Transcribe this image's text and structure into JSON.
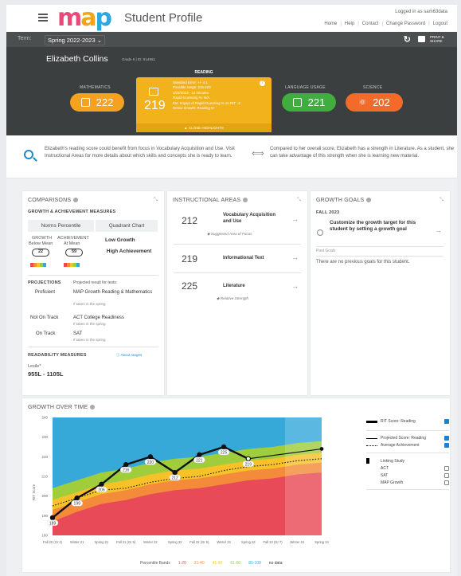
{
  "app": {
    "page_title": "Student Profile",
    "logged_in": "Logged in as sam63data",
    "links": [
      "Home",
      "Help",
      "Contact",
      "Change Password",
      "Logout"
    ]
  },
  "termbar": {
    "label": "Term:",
    "term": "Spring 2022-2023",
    "print_label": "PRINT & SHARE"
  },
  "student": {
    "name": "Elizabeth Collins",
    "meta": "Grade 6  |  ID: 514961"
  },
  "subjects": {
    "math": {
      "label": "MATHEMATICS",
      "score": "222",
      "color": "#f4a21f"
    },
    "reading": {
      "label": "READING",
      "score": "219",
      "color": "#f2b21c",
      "details": [
        "Standard Error: +/- 4.1",
        "Possible range: 215-223",
        "3/23/2023 - 12 minutes",
        "Rapid-Guessing %: N/A",
        "Est. Impact of Rapid-Guessing % on RIT: -2",
        "Derive Growth: Reading 6+"
      ],
      "close": "▲ CLOSE HIGHLIGHTS"
    },
    "language": {
      "label": "LANGUAGE USAGE",
      "score": "221",
      "color": "#3fae3f"
    },
    "science": {
      "label": "SCIENCE",
      "score": "202",
      "color": "#f26b2a"
    }
  },
  "insights": [
    "Elizabeth's reading score could benefit from focus in Vocabulary Acquisition and Use. Visit Instructional Areas for more details about which skills and concepts she is ready to learn.",
    "Compared to her overall score, Elizabeth has a strength in Literature. As a student, she can take advantage of this strength when she is learning new material."
  ],
  "comparisons": {
    "title": "COMPARISONS",
    "subtitle": "GROWTH & ACHIEVEMENT MEASURES",
    "tab_norms": "Norms Percentile",
    "tab_quadrant": "Quadrant Chart",
    "growth_label": "GROWTH",
    "growth_desc": "Below Mean",
    "growth_pct": "22",
    "achievement_label": "ACHIEVEMENT",
    "achievement_desc": "At Mean",
    "achievement_pct": "59",
    "quadrant_growth": "Low Growth",
    "quadrant_achievement": "High Achievement",
    "projections_title": "PROJECTIONS",
    "projections_sub": "Projected result for tests:",
    "projections": [
      {
        "status": "Proficient",
        "test": "MAP Growth Reading & Mathematics",
        "note": "If taken in the spring"
      },
      {
        "status": "Not On Track",
        "test": "ACT College Readiness",
        "note": "If taken in the spring"
      },
      {
        "status": "On Track",
        "test": "SAT",
        "note": "If taken in the spring"
      }
    ],
    "readability_title": "READABILITY MEASURES",
    "readability_link": "About ranges",
    "lexile_label": "Lexile*",
    "lexile_value": "955L - 1105L"
  },
  "instructional": {
    "title": "INSTRUCTIONAL AREAS",
    "areas": [
      {
        "score": "212",
        "name": "Vocabulary Acquisition and Use",
        "tag": "Suggested Area of Focus"
      },
      {
        "score": "219",
        "name": "Informational Text",
        "tag": ""
      },
      {
        "score": "225",
        "name": "Literature",
        "tag": "Relative Strength"
      }
    ]
  },
  "growth_goals": {
    "title": "GROWTH GOALS",
    "term": "FALL 2023",
    "cta": "Customize the growth target for this student by setting a growth goal",
    "past_label": "Past Goals",
    "past_text": "There are no previous goals for this student."
  },
  "growth_chart": {
    "title": "GROWTH OVER TIME",
    "legend": {
      "rit": "RIT Score: Reading",
      "projected": "Projected Score: Reading",
      "average": "Average Achievement",
      "linking": "Linking Study",
      "act": "ACT",
      "sat": "SAT",
      "map": "MAP Growth"
    },
    "percentile_label": "Percentile Bands",
    "bands": [
      "1-20",
      "21-40",
      "41-60",
      "61-80",
      "81-100",
      "no data"
    ],
    "band_colors": [
      "#e84b57",
      "#f48b3b",
      "#f7c12a",
      "#9fcd3c",
      "#37a9d9"
    ]
  },
  "chart_data": {
    "type": "line",
    "title": "GROWTH OVER TIME",
    "ylabel": "RIT Score",
    "xlabel": "",
    "ylim": [
      180,
      240
    ],
    "yticks": [
      180,
      190,
      200,
      210,
      220,
      230,
      240
    ],
    "categories": [
      "Fall 20 (Gr 4)",
      "Winter 21",
      "Spring 21",
      "Fall 21 (Gr 5)",
      "Winter 22",
      "Spring 22",
      "Fall 22 (Gr 6)",
      "Winter 23",
      "Spring 23",
      "Fall 23 (Gr 7)",
      "Winter 24",
      "Spring 24"
    ],
    "series": [
      {
        "name": "RIT Score: Reading",
        "x": [
          0,
          1,
          2,
          3,
          4,
          5,
          6,
          7,
          8
        ],
        "values": [
          189,
          199,
          206,
          216,
          220,
          212,
          221,
          225,
          219
        ]
      },
      {
        "name": "Projected Score: Reading",
        "x": [
          8,
          11
        ],
        "values": [
          219,
          224
        ]
      },
      {
        "name": "Average Achievement",
        "x": [
          0,
          1,
          2,
          3,
          4,
          5,
          6,
          7,
          8,
          9,
          10,
          11
        ],
        "values": [
          195,
          199,
          203,
          204,
          207,
          209,
          210,
          213,
          215,
          216,
          218,
          219
        ]
      }
    ],
    "bands": {
      "labels": [
        "1-20",
        "21-40",
        "41-60",
        "61-80",
        "81-100"
      ],
      "upper_bounds": [
        [
          187,
          192,
          196,
          198,
          201,
          203,
          204,
          206,
          208,
          209,
          211,
          212
        ],
        [
          193,
          197,
          201,
          203,
          206,
          208,
          209,
          211,
          213,
          214,
          216,
          217
        ],
        [
          198,
          202,
          206,
          208,
          211,
          213,
          214,
          216,
          218,
          219,
          221,
          222
        ],
        [
          204,
          208,
          212,
          214,
          217,
          219,
          220,
          222,
          224,
          225,
          227,
          228
        ],
        [
          240,
          240,
          240,
          240,
          240,
          240,
          240,
          240,
          240,
          240,
          240,
          240
        ]
      ]
    },
    "legend": "right",
    "grid": false
  }
}
